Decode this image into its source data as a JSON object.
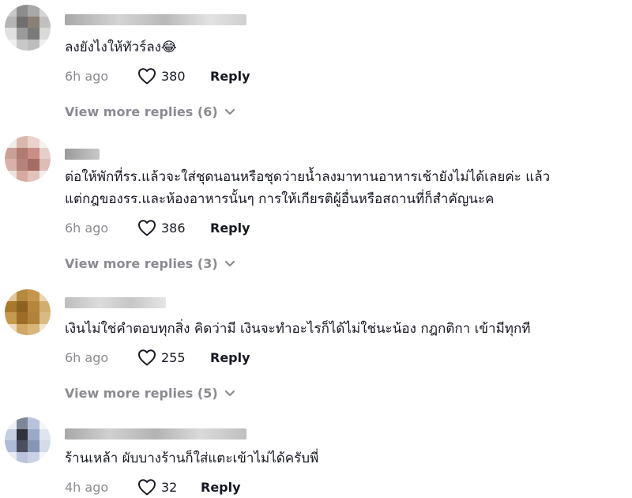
{
  "comments": [
    {
      "text": "ลงยังไงให้ทัวร์ลง😂",
      "time": "6h ago",
      "likes": "380",
      "reply_label": "Reply",
      "view_more": "View more replies (6)"
    },
    {
      "text": "ต่อให้พักที่รร.แล้วจะใส่ชุดนอนหรือชุดว่ายน้ำลงมาทานอาหารเช้ายังไม่ได้เลยค่ะ แล้ว\nแต่กฎของรร.และห้องอาหารนั้นๆ การให้เกียรติผู้อื่นหรือสถานที่ก็สำคัญนะค",
      "time": "6h ago",
      "likes": "386",
      "reply_label": "Reply",
      "view_more": "View more replies (3)"
    },
    {
      "text": "เงินไม่ใช่คำตอบทุกสิ่ง คิดว่ามี เงินจะทำอะไรก็ได้ไม่ใช่นะน้อง กฎกติกา เข้ามีทุกที",
      "time": "6h ago",
      "likes": "255",
      "reply_label": "Reply",
      "view_more": "View more replies (5)"
    },
    {
      "text": "ร้านเหล้า ผับบางร้านก็ใส่แตะเข้าไม่ได้ครับพี่",
      "time": "4h ago",
      "likes": "32",
      "reply_label": "Reply"
    }
  ]
}
